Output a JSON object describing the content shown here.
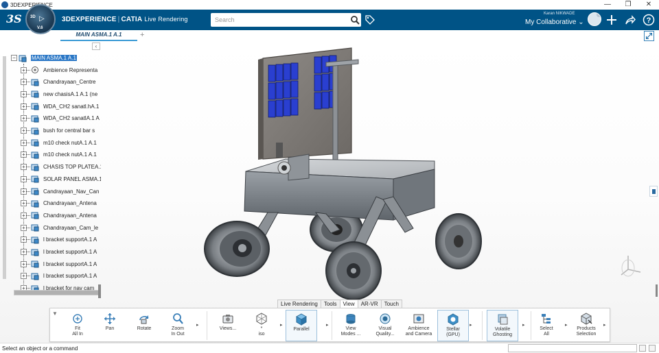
{
  "window": {
    "title": "3DEXPERIENCE",
    "controls": [
      "—",
      "❐",
      "✕"
    ]
  },
  "topbar": {
    "logo": "3S",
    "compass": {
      "label_3d": "3D",
      "version": "V.6"
    },
    "brand_main": "3DEXPERIENCE",
    "brand_product": "CATIA",
    "brand_app": "Live Rendering",
    "search_placeholder": "Search",
    "user_name": "Karan NIKWADE",
    "collab_space": "My Collaborative",
    "colors": {
      "bar": "#005386",
      "accent": "#3a9bd5"
    }
  },
  "tabs": {
    "active": "MAIN ASMA.1 A.1",
    "add": "+"
  },
  "tree": {
    "collapse_glyph": "‹",
    "root": {
      "toggle": "−",
      "label": "MAIN ASMA.1 A.1"
    },
    "items": [
      {
        "toggle": "+",
        "icon": "ambience-icon",
        "label": "Ambience Representa"
      },
      {
        "toggle": "+",
        "icon": "product-icon",
        "label": "Chandrayaan_Centre"
      },
      {
        "toggle": "+",
        "icon": "product-icon",
        "label": "new chasisA.1 A.1 (ne"
      },
      {
        "toggle": "+",
        "icon": "product-icon",
        "label": "WDA_CH2 sanatl.hA.1"
      },
      {
        "toggle": "+",
        "icon": "product-icon",
        "label": "WDA_CH2 sanatlA.1 A"
      },
      {
        "toggle": "+",
        "icon": "product-icon",
        "label": "bush for central bar s"
      },
      {
        "toggle": "+",
        "icon": "product-icon",
        "label": "m10 check nutA.1 A.1"
      },
      {
        "toggle": "+",
        "icon": "product-icon",
        "label": "m10 check nutA.1 A.1"
      },
      {
        "toggle": "+",
        "icon": "product-icon",
        "label": "CHASIS TOP PLATEA.1"
      },
      {
        "toggle": "+",
        "icon": "product-icon",
        "label": "SOLAR PANEL ASMA.1"
      },
      {
        "toggle": "+",
        "icon": "product-icon",
        "label": "Candrayaan_Nav_Can"
      },
      {
        "toggle": "+",
        "icon": "product-icon",
        "label": "Chandrayaan_Antena"
      },
      {
        "toggle": "+",
        "icon": "product-icon",
        "label": "Chandrayaan_Antena"
      },
      {
        "toggle": "+",
        "icon": "product-icon",
        "label": "Chandrayaan_Cam_le"
      },
      {
        "toggle": "+",
        "icon": "product-icon",
        "label": "l bracket supportA.1 A"
      },
      {
        "toggle": "+",
        "icon": "product-icon",
        "label": "l bracket supportA.1 A"
      },
      {
        "toggle": "+",
        "icon": "product-icon",
        "label": "l bracket supportA.1 A"
      },
      {
        "toggle": "+",
        "icon": "product-icon",
        "label": "l bracket supportA.1 A"
      },
      {
        "toggle": "+",
        "icon": "product-icon",
        "label": "l bracket for nav cam"
      }
    ]
  },
  "actionbar": {
    "tabs": [
      "Live Rendering",
      "Tools",
      "View",
      "AR-VR",
      "Touch"
    ],
    "active_tab": "View",
    "handle": "▼",
    "more": "▸",
    "commands": [
      {
        "id": "fit",
        "label": "Fit\nAll In",
        "icon": "fit-all-icon"
      },
      {
        "id": "pan",
        "label": "Pan",
        "icon": "pan-icon"
      },
      {
        "id": "rotate",
        "label": "Rotate",
        "icon": "rotate-icon"
      },
      {
        "id": "zoom",
        "label": "Zoom\nIn Out",
        "icon": "zoom-icon"
      },
      {
        "id": "views",
        "label": "Views...",
        "icon": "views-camera-icon"
      },
      {
        "id": "iso",
        "label": "*\niso",
        "icon": "iso-cube-icon"
      },
      {
        "id": "parallel",
        "label": "Parallel",
        "icon": "parallel-cube-icon"
      },
      {
        "id": "viewmodes",
        "label": "View\nModes ...",
        "icon": "view-modes-icon"
      },
      {
        "id": "visual",
        "label": "Visual\nQuality...",
        "icon": "visual-quality-icon"
      },
      {
        "id": "ambience",
        "label": "Ambience\nand Camera",
        "icon": "ambience-camera-icon"
      },
      {
        "id": "stellar",
        "label": "Stellar\n(GPU)",
        "icon": "stellar-gpu-icon"
      },
      {
        "id": "ghosting",
        "label": "Volatile\nGhosting",
        "icon": "volatile-ghosting-icon"
      },
      {
        "id": "selectall",
        "label": "Select\nAll",
        "icon": "select-all-icon"
      },
      {
        "id": "products",
        "label": "Products\nSelection",
        "icon": "products-selection-icon"
      }
    ]
  },
  "status": {
    "message": "Select an object or a command"
  }
}
